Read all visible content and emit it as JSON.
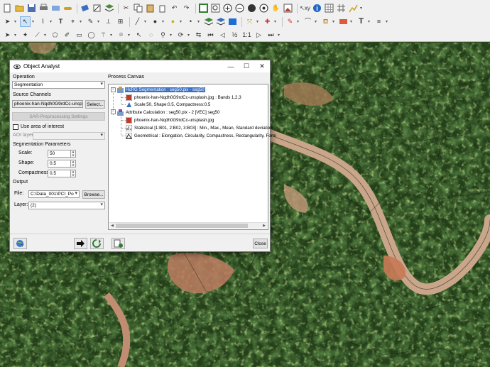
{
  "dialog": {
    "title": "Object Analyst",
    "operation_label": "Operation",
    "operation_value": "Segmentation",
    "source_channels_label": "Source Channels",
    "source_value": "phoenix-han-Nqdh0G9rdCc-unsplash",
    "select_button": "Select...",
    "sar_button": "SAR-Preprocessing Settings",
    "use_aoi_label": "Use area of interest",
    "aoi_layer_label": "AOI layer:",
    "seg_params_label": "Segmentation Parameters",
    "scale_label": "Scale:",
    "scale_value": "50",
    "shape_label": "Shape:",
    "shape_value": "0.5",
    "compactness_label": "Compactness:",
    "compactness_value": "0.5",
    "output_label": "Output",
    "file_label": "File:",
    "file_value": "C:\\Data_001\\PCI_Po",
    "browse_button": "Browse...",
    "layer_label": "Layer:",
    "layer_value": "(2)",
    "process_canvas_label": "Process Canvas",
    "close_button": "Close",
    "tree": [
      {
        "text": "HcRG Segmentation : seg50.pix - seg50",
        "selected": true
      },
      {
        "text": "phoenix-han-Nqdh0G9rdCc-unsplash.jpg : Bands 1,2,3"
      },
      {
        "text": "Scale:50, Shape:0.5, Compactness:0.5"
      },
      {
        "text": "Attribute Calculation : seg50.pix -   2 [VEC] seg50"
      },
      {
        "text": "phoenix-han-Nqdh0G9rdCc-unsplash.jpg"
      },
      {
        "text": "Statistical [1:B01, 2:B02, 3:B03] : Min., Max., Mean, Standard deviation"
      },
      {
        "text": "Geometrical : Elongation, Circularity, Compactness, Rectangularity, Form"
      }
    ]
  },
  "toolbar": {
    "zoom_half": "½",
    "zoom_text": "1:1"
  }
}
